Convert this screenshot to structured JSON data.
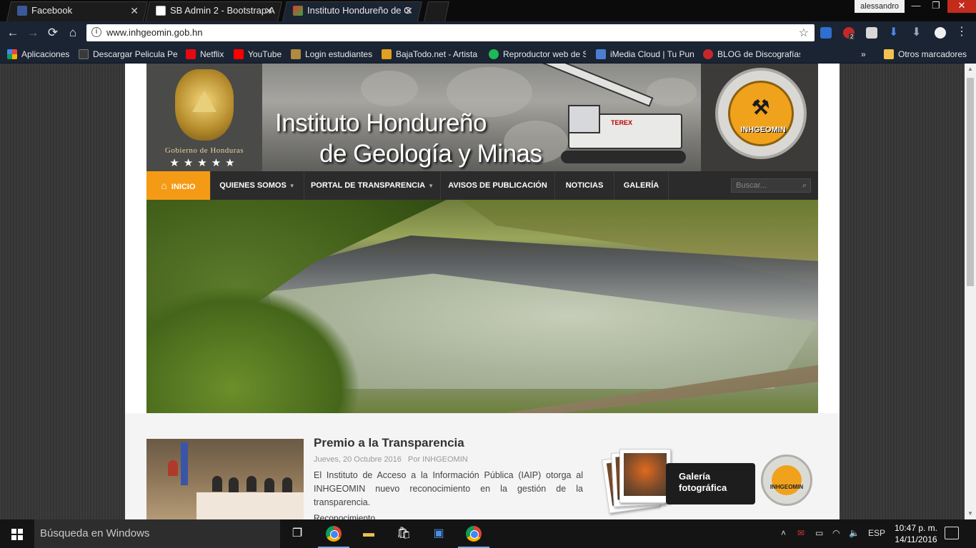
{
  "browser": {
    "tabs": [
      {
        "title": "Facebook",
        "favicon_color": "#3b5998"
      },
      {
        "title": "SB Admin 2 - Bootstrap A",
        "favicon_color": "#ffffff"
      },
      {
        "title": "Instituto Hondureño de G",
        "favicon_color": "#3aa14a",
        "active": true
      }
    ],
    "profile_name": "alessandro",
    "url": "www.inhgeomin.gob.hn",
    "bookmarks": [
      {
        "label": "Aplicaciones",
        "icon": "apps-grid-icon",
        "color": "#e8453c"
      },
      {
        "label": "Descargar Pelicula Pe",
        "icon": "amazon-icon",
        "color": "#3a3a3a"
      },
      {
        "label": "Netflix",
        "icon": "netflix-icon",
        "color": "#e50914"
      },
      {
        "label": "YouTube",
        "icon": "youtube-icon",
        "color": "#ff0000"
      },
      {
        "label": "Login estudiantes",
        "icon": "page-icon",
        "color": "#b08a40"
      },
      {
        "label": "BajaTodo.net - Artista",
        "icon": "bajatodo-icon",
        "color": "#e0a020"
      },
      {
        "label": "Reproductor web de S",
        "icon": "spotify-icon",
        "color": "#1db954"
      },
      {
        "label": "iMedia Cloud | Tu Pun",
        "icon": "imedia-icon",
        "color": "#4a7fd0"
      },
      {
        "label": "BLOG de Discografías",
        "icon": "blog-icon",
        "color": "#c62828"
      }
    ],
    "more_bookmarks_glyph": "»",
    "other_bookmarks": "Otros marcadores",
    "adblock_badge": "2"
  },
  "site": {
    "banner": {
      "title_line1": "Instituto Hondureño",
      "title_line2": "de Geología y Minas",
      "crest_label": "Gobierno de Honduras",
      "crest_stars": "★★★★★",
      "logo_text": "INHGEOMIN",
      "excavator_brand": "TEREX"
    },
    "nav": {
      "items": [
        {
          "label": "INICIO",
          "active": true,
          "icon": "home-icon"
        },
        {
          "label": "QUIENES SOMOS",
          "dropdown": true
        },
        {
          "label": "PORTAL DE TRANSPARENCIA",
          "dropdown": true
        },
        {
          "label": "AVISOS DE PUBLICACIÓN"
        },
        {
          "label": "NOTICIAS"
        },
        {
          "label": "GALERÍA"
        }
      ],
      "search_placeholder": "Buscar...",
      "accent": "#f59a15"
    },
    "post": {
      "title": "Premio a la Transparencia",
      "date": "Jueves, 20 Octubre 2016",
      "author": "Por INHGEOMIN",
      "excerpt": "El Instituto de Acceso a la Información Pública (IAIP) otorga al INHGEOMIN nuevo reconocimiento en la gestión de la transparencia.",
      "more_partial": "Reconocimiento"
    },
    "gallery_widget": {
      "label_line1": "Galería",
      "label_line2": "fotográfica"
    },
    "side_logo_text": "INHGEOMIN"
  },
  "taskbar": {
    "search_placeholder": "Búsqueda en Windows",
    "language": "ESP",
    "time": "10:47 p. m.",
    "date": "14/11/2016"
  }
}
